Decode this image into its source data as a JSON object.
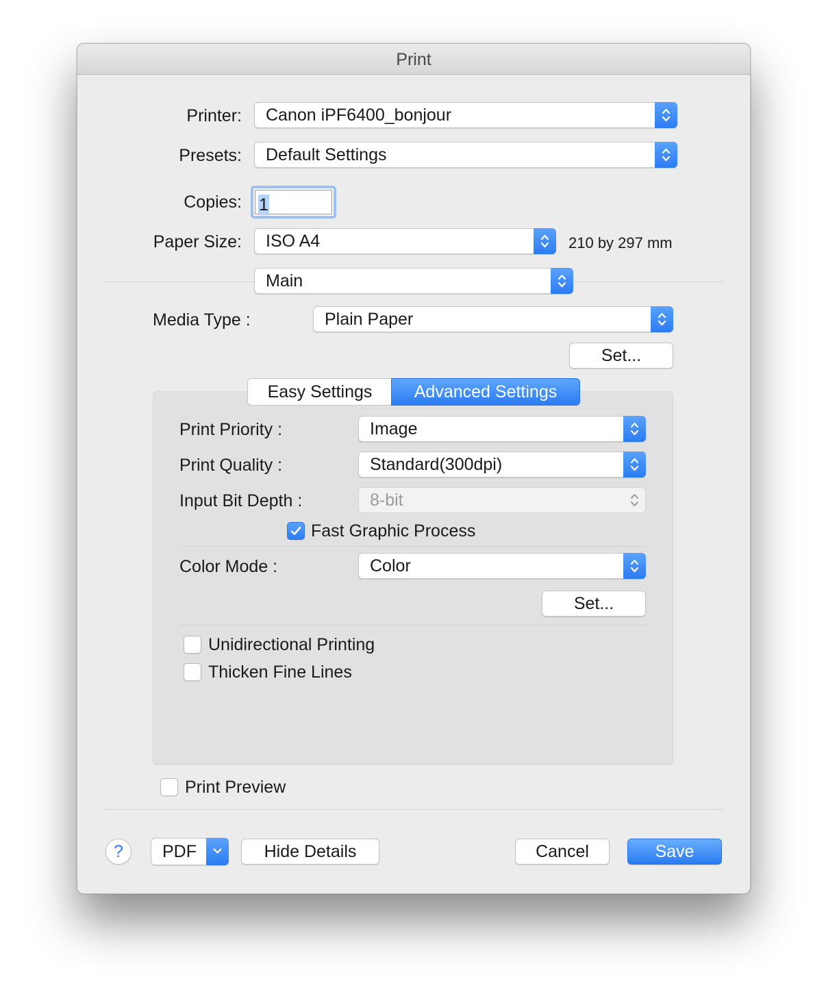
{
  "window": {
    "title": "Print"
  },
  "printer": {
    "label": "Printer:",
    "value": "Canon iPF6400_bonjour"
  },
  "presets": {
    "label": "Presets:",
    "value": "Default Settings"
  },
  "copies": {
    "label": "Copies:",
    "value": "1"
  },
  "paper_size": {
    "label": "Paper Size:",
    "value": "ISO A4",
    "dimensions": "210 by 297 mm"
  },
  "panel": {
    "value": "Main"
  },
  "media_type": {
    "label": "Media Type :",
    "value": "Plain Paper",
    "set_label": "Set..."
  },
  "tabs": [
    {
      "label": "Easy Settings",
      "selected": false
    },
    {
      "label": "Advanced Settings",
      "selected": true
    }
  ],
  "advanced": {
    "print_priority": {
      "label": "Print Priority :",
      "value": "Image"
    },
    "print_quality": {
      "label": "Print Quality :",
      "value": "Standard(300dpi)"
    },
    "input_bit_depth": {
      "label": "Input Bit Depth :",
      "value": "8-bit",
      "enabled": false
    },
    "fast_graphic": {
      "label": "Fast Graphic Process",
      "checked": true
    },
    "color_mode": {
      "label": "Color Mode :",
      "value": "Color",
      "set_label": "Set..."
    },
    "unidirectional": {
      "label": "Unidirectional Printing",
      "checked": false
    },
    "thicken_lines": {
      "label": "Thicken Fine Lines",
      "checked": false
    }
  },
  "print_preview": {
    "label": "Print Preview",
    "checked": false
  },
  "footer": {
    "help": "?",
    "pdf": "PDF",
    "hide_details": "Hide Details",
    "cancel": "Cancel",
    "save": "Save"
  },
  "colors": {
    "accent": "#2c7cf2",
    "window_bg": "#ececec",
    "group_bg": "#e1e1e1"
  },
  "icons": {
    "popup": "up-down-chevron-icon",
    "check": "checkmark-icon",
    "dropdown": "chevron-down-icon"
  }
}
